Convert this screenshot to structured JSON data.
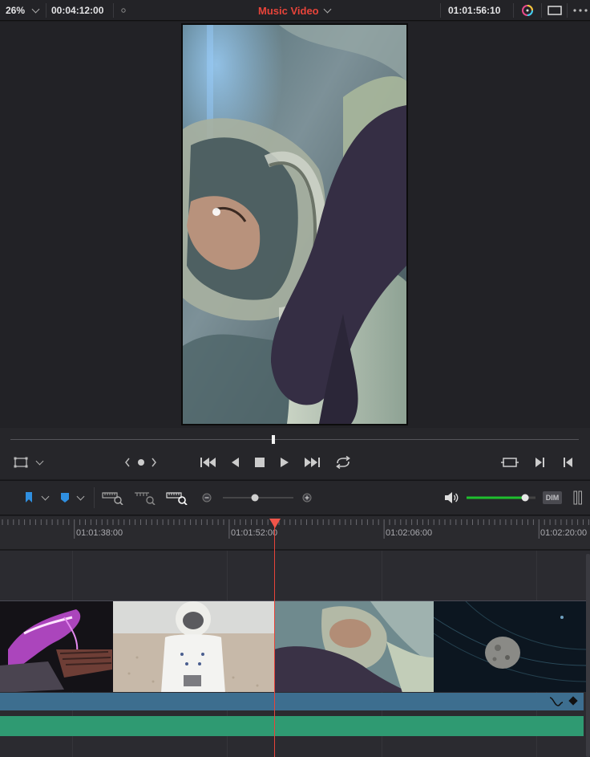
{
  "topbar": {
    "zoom": "26%",
    "duration_timecode": "00:04:12:00",
    "timeline_name": "Music Video",
    "current_timecode": "01:01:56:10",
    "icons": [
      "chevron-down-icon",
      "dot-icon",
      "color-effects-icon",
      "viewer-mode-icon",
      "more-options-icon"
    ]
  },
  "viewer": {
    "preview_description_icon": "video-frame"
  },
  "transport": {
    "icons": [
      "transform-icon",
      "prev-edit-icon",
      "jog-dot-icon",
      "next-edit-icon",
      "jump-to-start-icon",
      "reverse-play-icon",
      "stop-icon",
      "play-icon",
      "jump-to-end-icon",
      "loop-icon",
      "match-frame-icon",
      "next-clip-icon",
      "previous-clip-icon"
    ]
  },
  "timeline_toolbar": {
    "dim_label": "DIM",
    "audio_level": 0.85,
    "zoom_level": 0.45,
    "colors": {
      "flag": "#2f8fe0",
      "marker": "#2f8fe0",
      "meter": "#1fbf2e"
    }
  },
  "ruler": {
    "timecodes": [
      "01:01:38:00",
      "01:01:52:00",
      "01:02:06:00",
      "01:02:20:00"
    ]
  },
  "tracks": {
    "video_clips": [
      "neon-figure",
      "astronaut-beach",
      "astronaut-closeup",
      "asteroid-space"
    ],
    "colors": {
      "audio1": "#3d6e8f",
      "audio2": "#2f9a72",
      "playhead": "#e8443a"
    }
  }
}
